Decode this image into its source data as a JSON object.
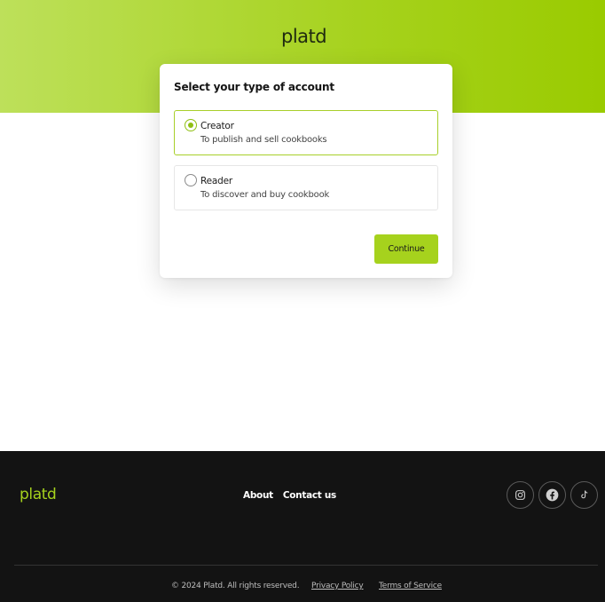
{
  "brand": {
    "logo_text": "platd",
    "accent": "#a6d21d",
    "dark": "#131313"
  },
  "card": {
    "title": "Select your type of account",
    "options": [
      {
        "label": "Creator",
        "description": "To publish and sell cookbooks",
        "selected": true
      },
      {
        "label": "Reader",
        "description": "To discover and buy cookbook",
        "selected": false
      }
    ],
    "continue_label": "Continue"
  },
  "footer": {
    "logo_text": "platd",
    "links": [
      "About",
      "Contact us"
    ],
    "social_icons": [
      "instagram-icon",
      "facebook-icon",
      "tiktok-icon"
    ],
    "copyright": "© 2024 Platd. All rights reserved.",
    "privacy_label": "Privacy Policy",
    "terms_label": "Terms of Service"
  }
}
